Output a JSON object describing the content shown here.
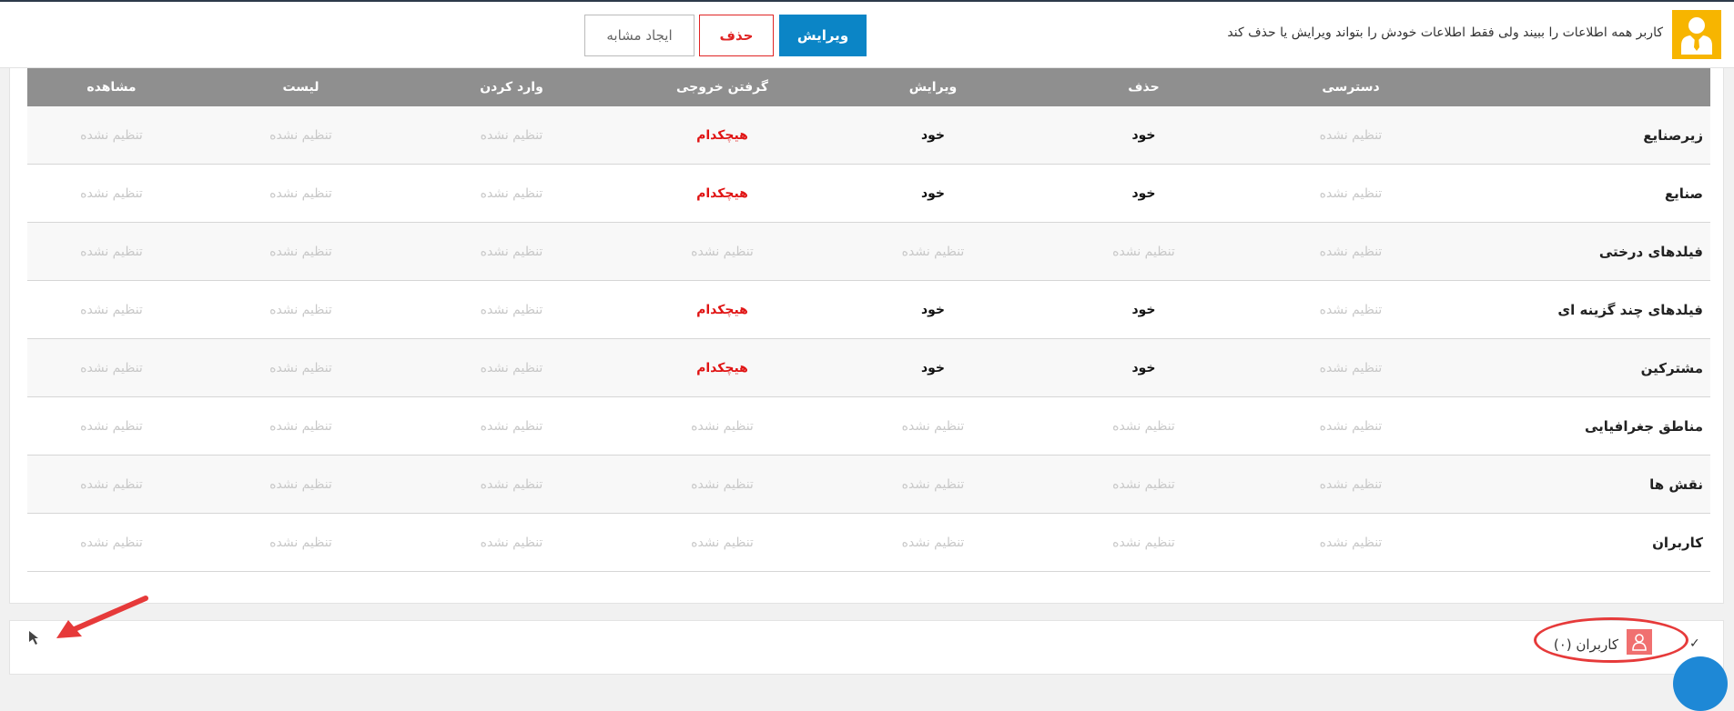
{
  "role": {
    "icon": "user-tie-icon",
    "description": "کاربر همه اطلاعات را ببیند ولی فقط اطلاعات خودش را بتواند ویرایش یا حذف کند"
  },
  "toolbar": {
    "edit_label": "ویرایش",
    "delete_label": "حذف",
    "duplicate_label": "ایجاد مشابه"
  },
  "table": {
    "columns": [
      "",
      "دسترسی",
      "حذف",
      "ویرایش",
      "گرفتن خروجی",
      "وارد کردن",
      "لیست",
      "مشاهده"
    ],
    "rows": [
      {
        "name": "زیرصنایع",
        "cells": [
          "تنظیم نشده",
          "خود",
          "خود",
          "هیچکدام",
          "تنظیم نشده",
          "تنظیم نشده",
          "تنظیم نشده"
        ]
      },
      {
        "name": "صنایع",
        "cells": [
          "تنظیم نشده",
          "خود",
          "خود",
          "هیچکدام",
          "تنظیم نشده",
          "تنظیم نشده",
          "تنظیم نشده"
        ]
      },
      {
        "name": "فیلدهای درختی",
        "cells": [
          "تنظیم نشده",
          "تنظیم نشده",
          "تنظیم نشده",
          "تنظیم نشده",
          "تنظیم نشده",
          "تنظیم نشده",
          "تنظیم نشده"
        ]
      },
      {
        "name": "فیلدهای چند گزینه ای",
        "cells": [
          "تنظیم نشده",
          "خود",
          "خود",
          "هیچکدام",
          "تنظیم نشده",
          "تنظیم نشده",
          "تنظیم نشده"
        ]
      },
      {
        "name": "مشترکین",
        "cells": [
          "تنظیم نشده",
          "خود",
          "خود",
          "هیچکدام",
          "تنظیم نشده",
          "تنظیم نشده",
          "تنظیم نشده"
        ]
      },
      {
        "name": "مناطق جغرافیایی",
        "cells": [
          "تنظیم نشده",
          "تنظیم نشده",
          "تنظیم نشده",
          "تنظیم نشده",
          "تنظیم نشده",
          "تنظیم نشده",
          "تنظیم نشده"
        ]
      },
      {
        "name": "نقش ها",
        "cells": [
          "تنظیم نشده",
          "تنظیم نشده",
          "تنظیم نشده",
          "تنظیم نشده",
          "تنظیم نشده",
          "تنظیم نشده",
          "تنظیم نشده"
        ]
      },
      {
        "name": "کاربران",
        "cells": [
          "تنظیم نشده",
          "تنظیم نشده",
          "تنظیم نشده",
          "تنظیم نشده",
          "تنظیم نشده",
          "تنظیم نشده",
          "تنظیم نشده"
        ]
      }
    ]
  },
  "users_section": {
    "icon": "user-icon",
    "label": "کاربران (۰)",
    "toggle_icon": "chevron-down-icon"
  },
  "colors": {
    "header_bg": "#8f8f8f",
    "primary": "#0b85c6",
    "danger": "#e02424",
    "role_icon_bg": "#f7b500",
    "annotation": "#e63a3a"
  }
}
